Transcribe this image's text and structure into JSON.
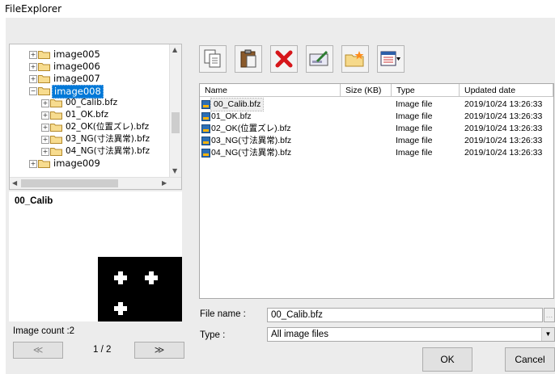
{
  "window": {
    "title": "FileExplorer"
  },
  "tree": {
    "items": [
      {
        "label": "image005",
        "level": 0,
        "expander": "+",
        "selected": false
      },
      {
        "label": "image006",
        "level": 0,
        "expander": "+",
        "selected": false
      },
      {
        "label": "image007",
        "level": 0,
        "expander": "+",
        "selected": false
      },
      {
        "label": "image008",
        "level": 0,
        "expander": "−",
        "selected": true
      },
      {
        "label": "00_Calib.bfz",
        "level": 1,
        "expander": "+",
        "selected": false
      },
      {
        "label": "01_OK.bfz",
        "level": 1,
        "expander": "+",
        "selected": false
      },
      {
        "label": "02_OK(位置ズレ).bfz",
        "level": 1,
        "expander": "+",
        "selected": false
      },
      {
        "label": "03_NG(寸法異常).bfz",
        "level": 1,
        "expander": "+",
        "selected": false
      },
      {
        "label": "04_NG(寸法異常).bfz",
        "level": 1,
        "expander": "+",
        "selected": false
      },
      {
        "label": "image009",
        "level": 0,
        "expander": "+",
        "selected": false
      }
    ]
  },
  "preview": {
    "title": "00_Calib"
  },
  "image_count": "Image count :2",
  "pager": {
    "prev": "≪",
    "page": "1 / 2",
    "next": "≫"
  },
  "toolbar": {
    "buttons": [
      "copy-icon",
      "paste-icon",
      "delete-icon",
      "rename-icon",
      "new-folder-icon",
      "view-icon"
    ]
  },
  "filelist": {
    "columns": [
      "Name",
      "Size (KB)",
      "Type",
      "Updated date"
    ],
    "rows": [
      {
        "name": "00_Calib.bfz",
        "size": "",
        "type": "Image file",
        "date": "2019/10/24 13:26:33",
        "selected": true
      },
      {
        "name": "01_OK.bfz",
        "size": "",
        "type": "Image file",
        "date": "2019/10/24 13:26:33",
        "selected": false
      },
      {
        "name": "02_OK(位置ズレ).bfz",
        "size": "",
        "type": "Image file",
        "date": "2019/10/24 13:26:33",
        "selected": false
      },
      {
        "name": "03_NG(寸法異常).bfz",
        "size": "",
        "type": "Image file",
        "date": "2019/10/24 13:26:33",
        "selected": false
      },
      {
        "name": "04_NG(寸法異常).bfz",
        "size": "",
        "type": "Image file",
        "date": "2019/10/24 13:26:33",
        "selected": false
      }
    ]
  },
  "form": {
    "file_name_label": "File name :",
    "file_name_value": "00_Calib.bfz",
    "type_label": "Type :",
    "type_value": "All image files"
  },
  "buttons": {
    "ok": "OK",
    "cancel": "Cancel"
  }
}
